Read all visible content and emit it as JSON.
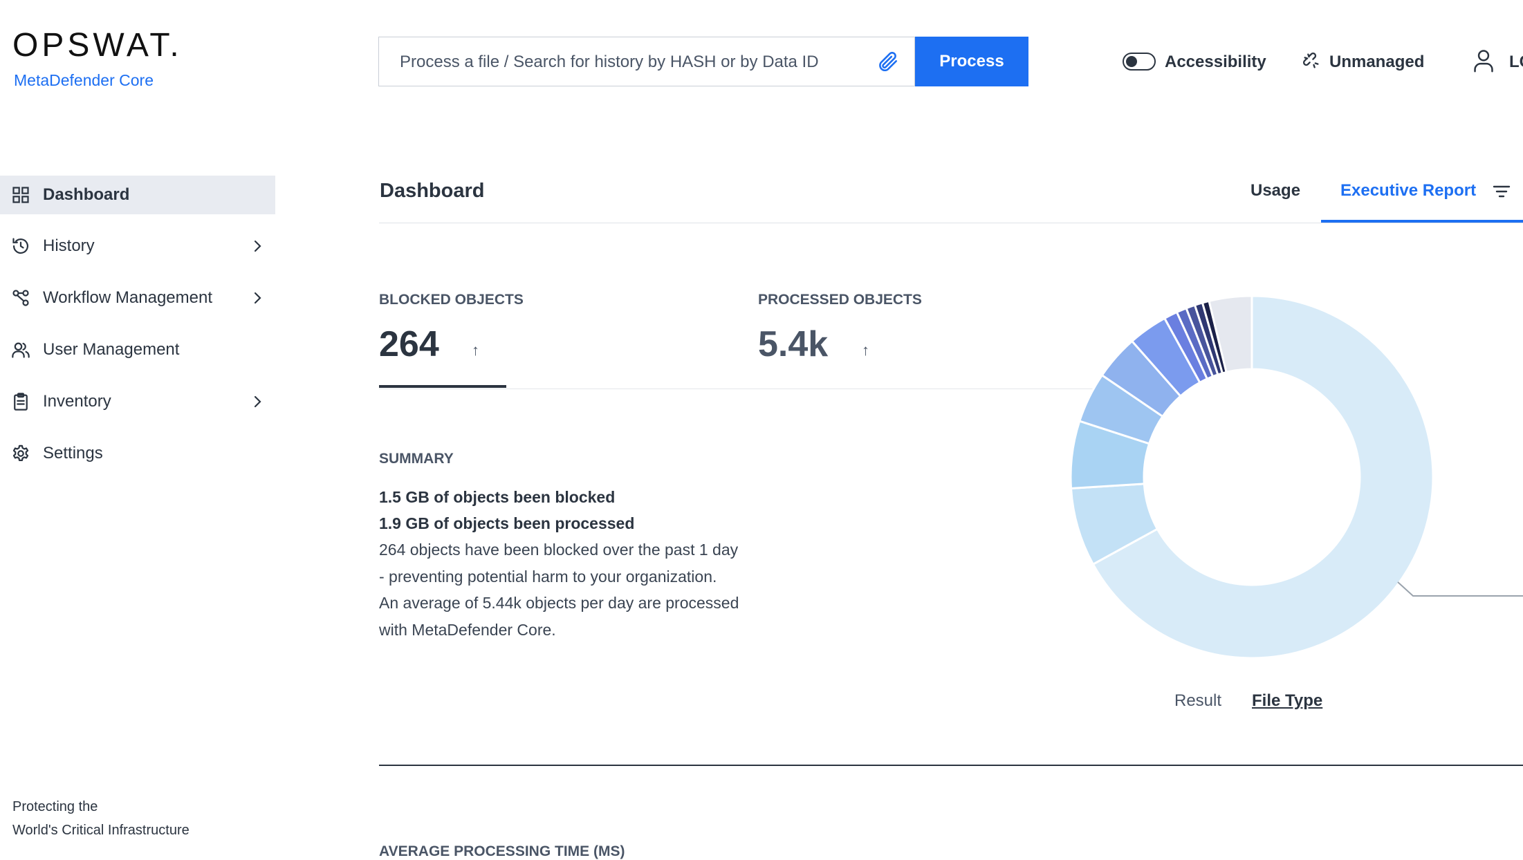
{
  "header": {
    "logo_text": "OPSWAT.",
    "product_name": "MetaDefender Core",
    "search_placeholder": "Process a file / Search for history by HASH or by Data ID",
    "process_label": "Process",
    "accessibility_label": "Accessibility",
    "unmanaged_label": "Unmanaged",
    "login_label_partial": "LC"
  },
  "sidebar": {
    "items": [
      {
        "label": "Dashboard",
        "icon": "dashboard-grid-icon",
        "active": true
      },
      {
        "label": "History",
        "icon": "history-icon",
        "has_children": true
      },
      {
        "label": "Workflow Management",
        "icon": "workflow-icon",
        "has_children": true
      },
      {
        "label": "User Management",
        "icon": "users-icon"
      },
      {
        "label": "Inventory",
        "icon": "clipboard-icon",
        "has_children": true
      },
      {
        "label": "Settings",
        "icon": "gear-icon"
      }
    ],
    "footer_line1": "Protecting the",
    "footer_line2": "World's Critical Infrastructure"
  },
  "main": {
    "title": "Dashboard",
    "tabs": [
      {
        "label": "Usage",
        "active": false
      },
      {
        "label": "Executive Report",
        "active": true
      }
    ],
    "stats": [
      {
        "label": "BLOCKED OBJECTS",
        "value": "264",
        "trend": "↑",
        "selected": true
      },
      {
        "label": "PROCESSED OBJECTS",
        "value": "5.4k",
        "trend": "↑",
        "selected": false
      }
    ],
    "summary": {
      "title": "SUMMARY",
      "lines": [
        "1.5 GB of objects been blocked",
        "1.9 GB of objects been processed",
        "264 objects have been blocked over the past 1 day",
        "- preventing potential harm to your organization.",
        "An average of 5.44k objects per day are processed",
        "with MetaDefender Core."
      ]
    },
    "chart_tabs": [
      {
        "label": "Result",
        "active": false
      },
      {
        "label": "File Type",
        "active": true
      }
    ],
    "next_section_label": "AVERAGE PROCESSING TIME (MS)"
  },
  "colors": {
    "accent": "#1d6ff2",
    "text": "#2b3440",
    "active_nav_bg": "#e8ebf1"
  },
  "chart_data": {
    "type": "pie",
    "donut": true,
    "values": [
      67.0,
      7.0,
      6.0,
      4.5,
      4.0,
      3.5,
      1.2,
      0.9,
      0.8,
      0.7,
      0.6,
      3.8
    ],
    "colors": [
      "#d8ebf8",
      "#c3e1f6",
      "#a9d3f3",
      "#9ec5f1",
      "#8fb2ee",
      "#7b9bee",
      "#6a7fe0",
      "#5a6bc4",
      "#48549c",
      "#2f3872",
      "#1b2148",
      "#e5e8ef"
    ],
    "labels": []
  }
}
